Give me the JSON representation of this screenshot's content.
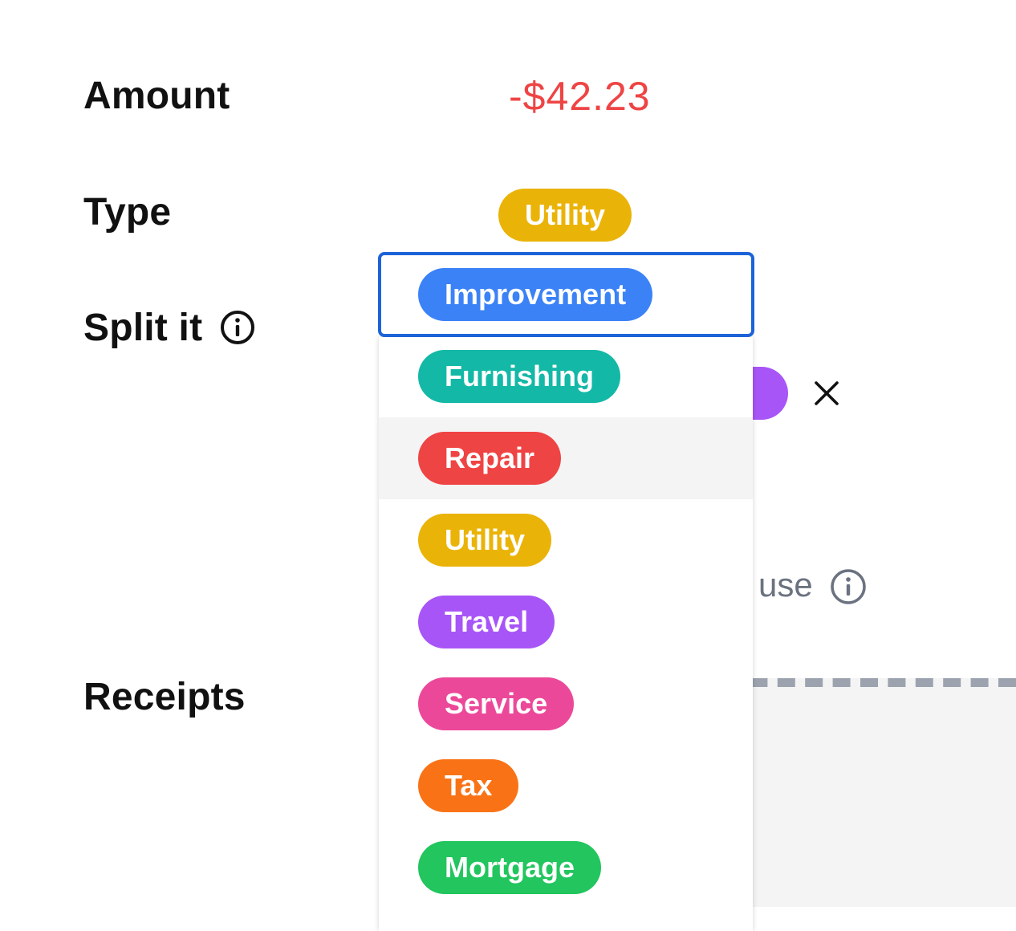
{
  "form": {
    "amount": {
      "label": "Amount",
      "value": "-$42.23",
      "value_color": "#ef4444"
    },
    "type": {
      "label": "Type",
      "selected": "Utility",
      "selected_color": "#eab308"
    },
    "split": {
      "label": "Split it",
      "info_icon": "info-circle-icon",
      "row_pill_color": "#a855f7",
      "remove_icon": "close-icon"
    },
    "business_use": {
      "visible_text": "use",
      "info_icon": "info-circle-icon"
    },
    "receipts": {
      "label": "Receipts"
    }
  },
  "dropdown": {
    "selected": {
      "label": "Improvement",
      "color": "#3b82f6"
    },
    "focus_border_color": "#1d63d8",
    "hovered_option": "Repair",
    "options": [
      {
        "label": "Furnishing",
        "color": "#14b8a6"
      },
      {
        "label": "Repair",
        "color": "#ef4444"
      },
      {
        "label": "Utility",
        "color": "#eab308"
      },
      {
        "label": "Travel",
        "color": "#a855f7"
      },
      {
        "label": "Service",
        "color": "#ec4899"
      },
      {
        "label": "Tax",
        "color": "#f97316"
      },
      {
        "label": "Mortgage",
        "color": "#22c55e"
      }
    ]
  }
}
